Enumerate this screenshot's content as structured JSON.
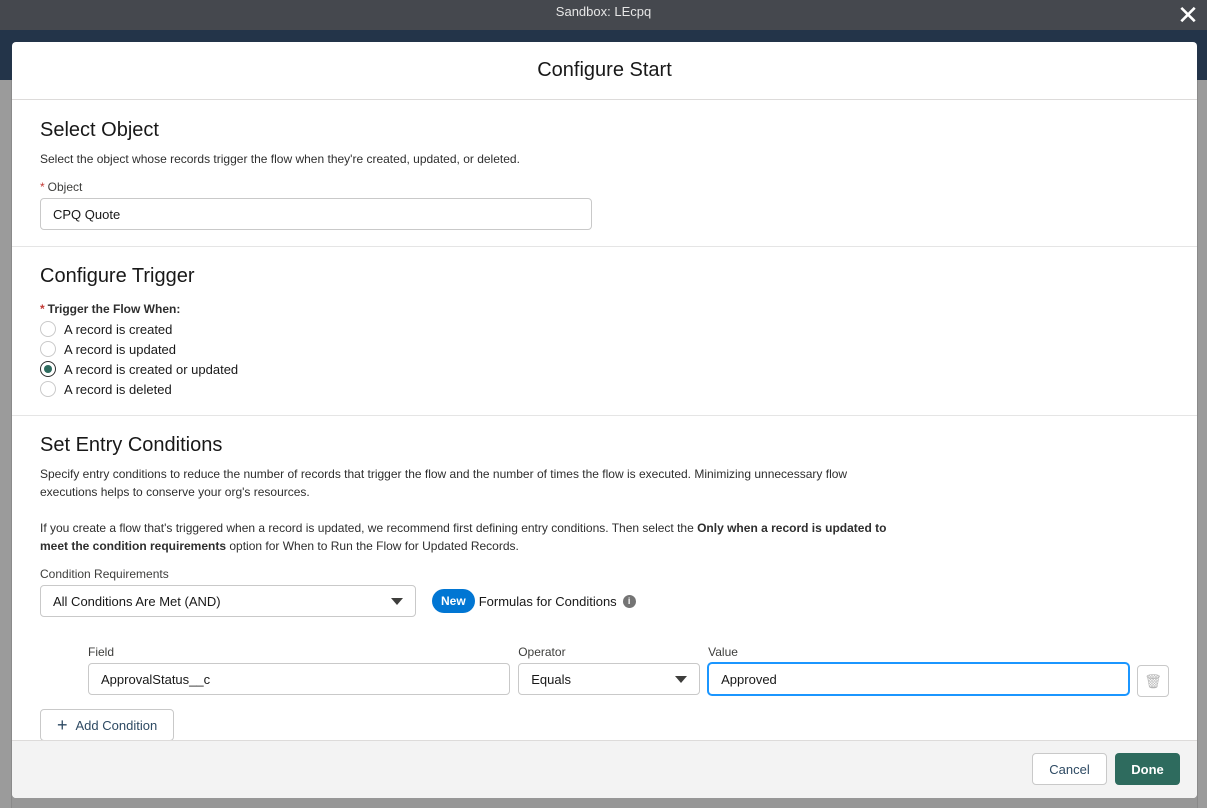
{
  "window": {
    "title": "Sandbox: LEcpq"
  },
  "modal": {
    "title": "Configure Start",
    "select_object": {
      "heading": "Select Object",
      "description": "Select the object whose records trigger the flow when they're created, updated, or deleted.",
      "object_label": "Object",
      "object_value": "CPQ Quote"
    },
    "configure_trigger": {
      "heading": "Configure Trigger",
      "label": "Trigger the Flow When:",
      "options": [
        {
          "label": "A record is created",
          "checked": false
        },
        {
          "label": "A record is updated",
          "checked": false
        },
        {
          "label": "A record is created or updated",
          "checked": true
        },
        {
          "label": "A record is deleted",
          "checked": false
        }
      ]
    },
    "entry_conditions": {
      "heading": "Set Entry Conditions",
      "description": "Specify entry conditions to reduce the number of records that trigger the flow and the number of times the flow is executed. Minimizing unnecessary flow executions helps to conserve your org's resources.",
      "note_prefix": "If you create a flow that's triggered when a record is updated, we recommend first defining entry conditions. Then select the ",
      "note_bold": "Only when a record is updated to meet the condition requirements",
      "note_suffix": " option for When to Run the Flow for Updated Records.",
      "requirements_label": "Condition Requirements",
      "requirements_value": "All Conditions Are Met (AND)",
      "new_badge": "New",
      "formulas_label": "Formulas for Conditions",
      "columns": {
        "field": "Field",
        "operator": "Operator",
        "value": "Value"
      },
      "condition": {
        "field": "ApprovalStatus__c",
        "operator": "Equals",
        "value": "Approved"
      },
      "add_condition": "Add Condition"
    },
    "footer": {
      "cancel": "Cancel",
      "done": "Done"
    }
  },
  "colors": {
    "brand": "#0176d3",
    "done": "#2e6b5e"
  }
}
